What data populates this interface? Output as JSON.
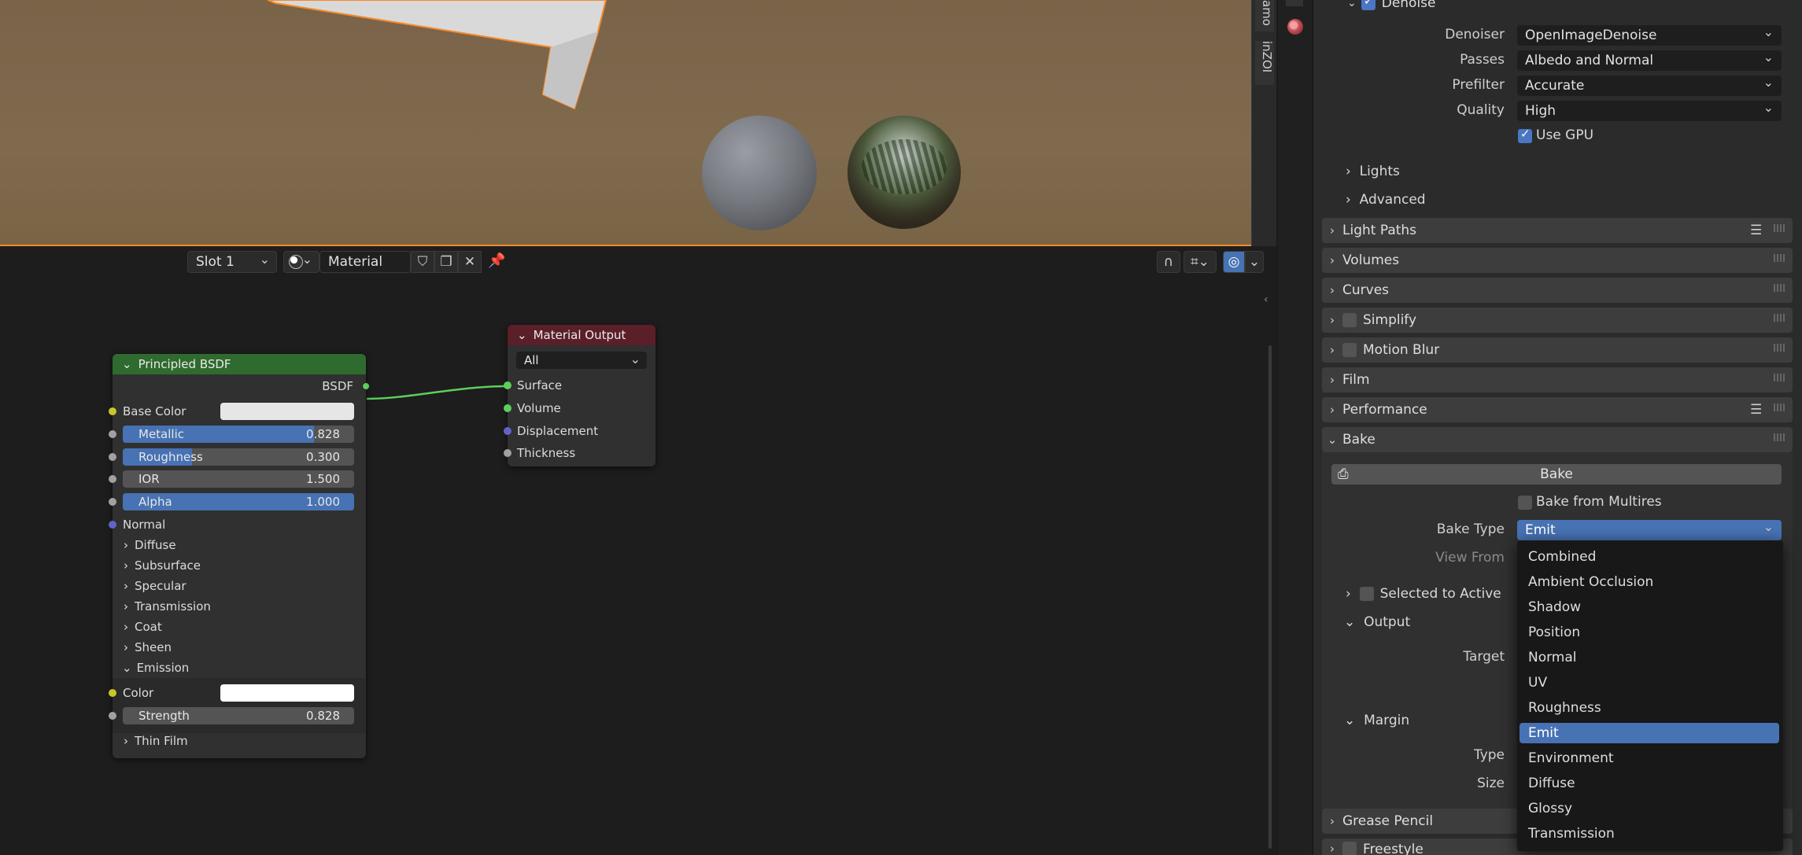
{
  "viewport": {
    "tabs": [
      "amo",
      "inZOI"
    ]
  },
  "node_header": {
    "slot": "Slot 1",
    "material": "Material"
  },
  "nodes": {
    "principled": {
      "title": "Principled BSDF",
      "output": "BSDF",
      "base_color": "Base Color",
      "metallic": {
        "label": "Metallic",
        "value": "0.828",
        "fraction": 0.828
      },
      "roughness": {
        "label": "Roughness",
        "value": "0.300",
        "fraction": 0.3
      },
      "ior": {
        "label": "IOR",
        "value": "1.500"
      },
      "alpha": {
        "label": "Alpha",
        "value": "1.000",
        "fraction": 1.0
      },
      "normal": "Normal",
      "panels": [
        "Diffuse",
        "Subsurface",
        "Specular",
        "Transmission",
        "Coat",
        "Sheen"
      ],
      "emission": "Emission",
      "color": "Color",
      "strength": {
        "label": "Strength",
        "value": "0.828"
      },
      "thin_film": "Thin Film"
    },
    "output": {
      "title": "Material Output",
      "target": "All",
      "inputs": [
        "Surface",
        "Volume",
        "Displacement",
        "Thickness"
      ]
    }
  },
  "props": {
    "denoise": {
      "header": "Denoise",
      "denoiser_label": "Denoiser",
      "denoiser": "OpenImageDenoise",
      "passes_label": "Passes",
      "passes": "Albedo and Normal",
      "prefilter_label": "Prefilter",
      "prefilter": "Accurate",
      "quality_label": "Quality",
      "quality": "High",
      "use_gpu": "Use GPU"
    },
    "sub_lights": "Lights",
    "sub_advanced": "Advanced",
    "sections": {
      "light_paths": "Light Paths",
      "volumes": "Volumes",
      "curves": "Curves",
      "simplify": "Simplify",
      "motion_blur": "Motion Blur",
      "film": "Film",
      "performance": "Performance",
      "bake": "Bake",
      "grease_pencil": "Grease Pencil",
      "freestyle": "Freestyle"
    },
    "bake": {
      "button": "Bake",
      "from_multires": "Bake from Multires",
      "type_label": "Bake Type",
      "type": "Emit",
      "view_from": "View From",
      "selected_to_active": "Selected to Active",
      "output": "Output",
      "target": "Target",
      "margin": "Margin",
      "type2": "Type",
      "size": "Size"
    }
  },
  "bake_menu": {
    "items": [
      "Combined",
      "Ambient Occlusion",
      "Shadow",
      "Position",
      "Normal",
      "UV",
      "Roughness",
      "Emit",
      "Environment",
      "Diffuse",
      "Glossy",
      "Transmission"
    ],
    "selected": "Emit"
  },
  "colors": {
    "accent": "#4772b3",
    "principled_header": "#2f6b2f",
    "output_header": "#5b1f2a",
    "active_border": "#f28a2a"
  }
}
